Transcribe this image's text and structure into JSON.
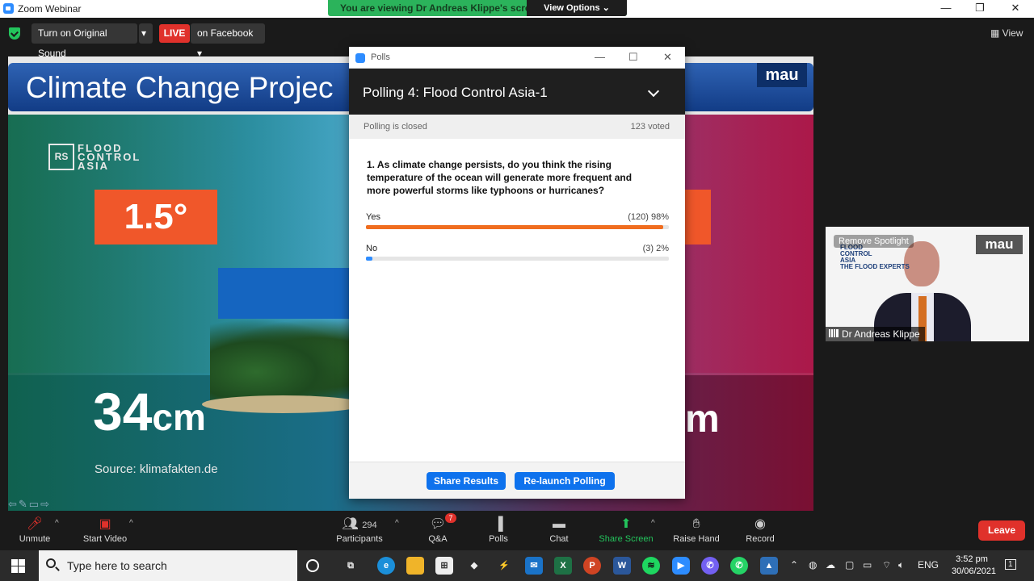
{
  "window": {
    "title": "Zoom Webinar",
    "minimize": "—",
    "maximize": "❐",
    "close": "✕"
  },
  "banner": {
    "message": "You are viewing Dr Andreas Klippe's screen",
    "view_options": "View Options ⌄"
  },
  "top_toolbar": {
    "original_sound": "Turn on Original Sound",
    "live_badge": "LIVE",
    "live_target": "on Facebook",
    "dropdown": "▾",
    "view": "View"
  },
  "slide": {
    "title": "Climate Change Projec",
    "mau": "mau",
    "logo_letters": "RS",
    "logo_lines": [
      "FLOOD",
      "CONTROL",
      "ASIA"
    ],
    "temp": "1.5°",
    "sea_level": "34",
    "sea_unit": "cm",
    "sea_level_right": "m",
    "source": "Source: klimafakten.de"
  },
  "polls": {
    "window_title": "Polls",
    "poll_name": "Polling 4: Flood Control Asia-1",
    "status": "Polling is closed",
    "voted": "123 voted",
    "question": "1. As climate change persists, do you think the rising temperature of the ocean will generate more frequent and more powerful storms like typhoons or hurricanes?",
    "answers": [
      {
        "label": "Yes",
        "result": "(120) 98%",
        "fraction": 0.98,
        "color": "#f06d1f"
      },
      {
        "label": "No",
        "result": "(3) 2%",
        "fraction": 0.02,
        "color": "#2d8cff"
      }
    ],
    "share_results": "Share Results",
    "relaunch": "Re-launch Polling"
  },
  "speaker": {
    "remove_spotlight": "Remove Spotlight",
    "name": "Dr Andreas Klippe",
    "mau": "mau",
    "logo_lines": [
      "FLOOD",
      "CONTROL",
      "ASIA"
    ],
    "tagline": "THE FLOOD EXPERTS"
  },
  "bottom_toolbar": {
    "unmute": "Unmute",
    "start_video": "Start Video",
    "participants": "Participants",
    "participant_count": "294",
    "qa": "Q&A",
    "qa_badge": "7",
    "polls": "Polls",
    "chat": "Chat",
    "share_screen": "Share Screen",
    "raise_hand": "Raise Hand",
    "record": "Record",
    "leave": "Leave"
  },
  "taskbar": {
    "search_placeholder": "Type here to search",
    "language": "ENG",
    "time": "3:52 pm",
    "date": "30/06/2021",
    "notifications": "1"
  }
}
